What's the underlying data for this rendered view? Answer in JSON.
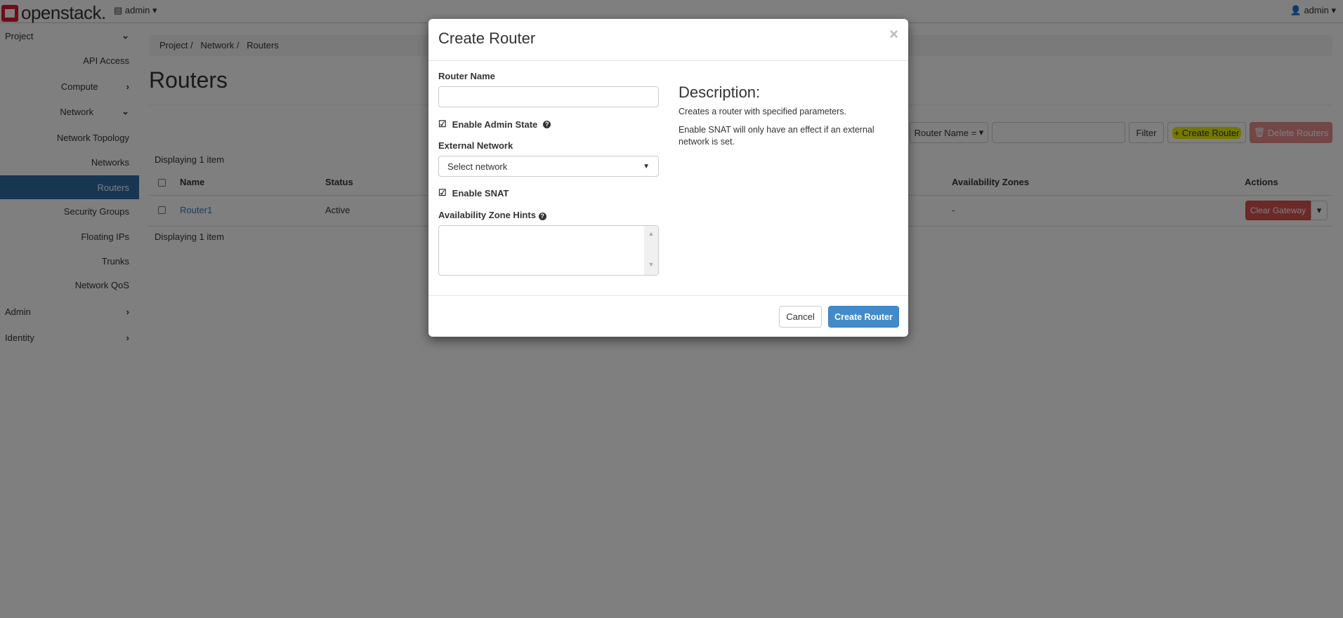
{
  "topbar": {
    "logo": "openstack.",
    "project": "admin",
    "user": "admin"
  },
  "sidebar": {
    "items": [
      {
        "label": "Project"
      },
      {
        "label": "API Access"
      },
      {
        "label": "Compute"
      },
      {
        "label": "Network"
      },
      {
        "label": "Network Topology"
      },
      {
        "label": "Networks"
      },
      {
        "label": "Routers"
      },
      {
        "label": "Security Groups"
      },
      {
        "label": "Floating IPs"
      },
      {
        "label": "Trunks"
      },
      {
        "label": "Network QoS"
      },
      {
        "label": "Admin"
      },
      {
        "label": "Identity"
      }
    ]
  },
  "breadcrumb": [
    "Project",
    "Network",
    "Routers"
  ],
  "page_title": "Routers",
  "toolbar": {
    "filter_field": "Router Name =",
    "filter_value": "",
    "filter_label": "Filter",
    "create_label": "Create Router",
    "delete_label": "Delete Routers"
  },
  "table": {
    "count_text": "Displaying 1 item",
    "headers": [
      "Name",
      "Status",
      "Availability Zones",
      "Actions"
    ],
    "rows": [
      {
        "name": "Router1",
        "status": "Active",
        "zones": "-",
        "action": "Clear Gateway"
      }
    ]
  },
  "modal": {
    "title": "Create Router",
    "close": "×",
    "router_name_label": "Router Name",
    "router_name_value": "",
    "admin_state_label": "Enable Admin State",
    "admin_state_checked": true,
    "external_network_label": "External Network",
    "external_network_value": "Select network",
    "snat_label": "Enable SNAT",
    "snat_checked": true,
    "az_hints_label": "Availability Zone Hints",
    "description_title": "Description:",
    "description_lines": [
      "Creates a router with specified parameters.",
      "Enable SNAT will only have an effect if an external network is set."
    ],
    "cancel_label": "Cancel",
    "submit_label": "Create Router"
  }
}
